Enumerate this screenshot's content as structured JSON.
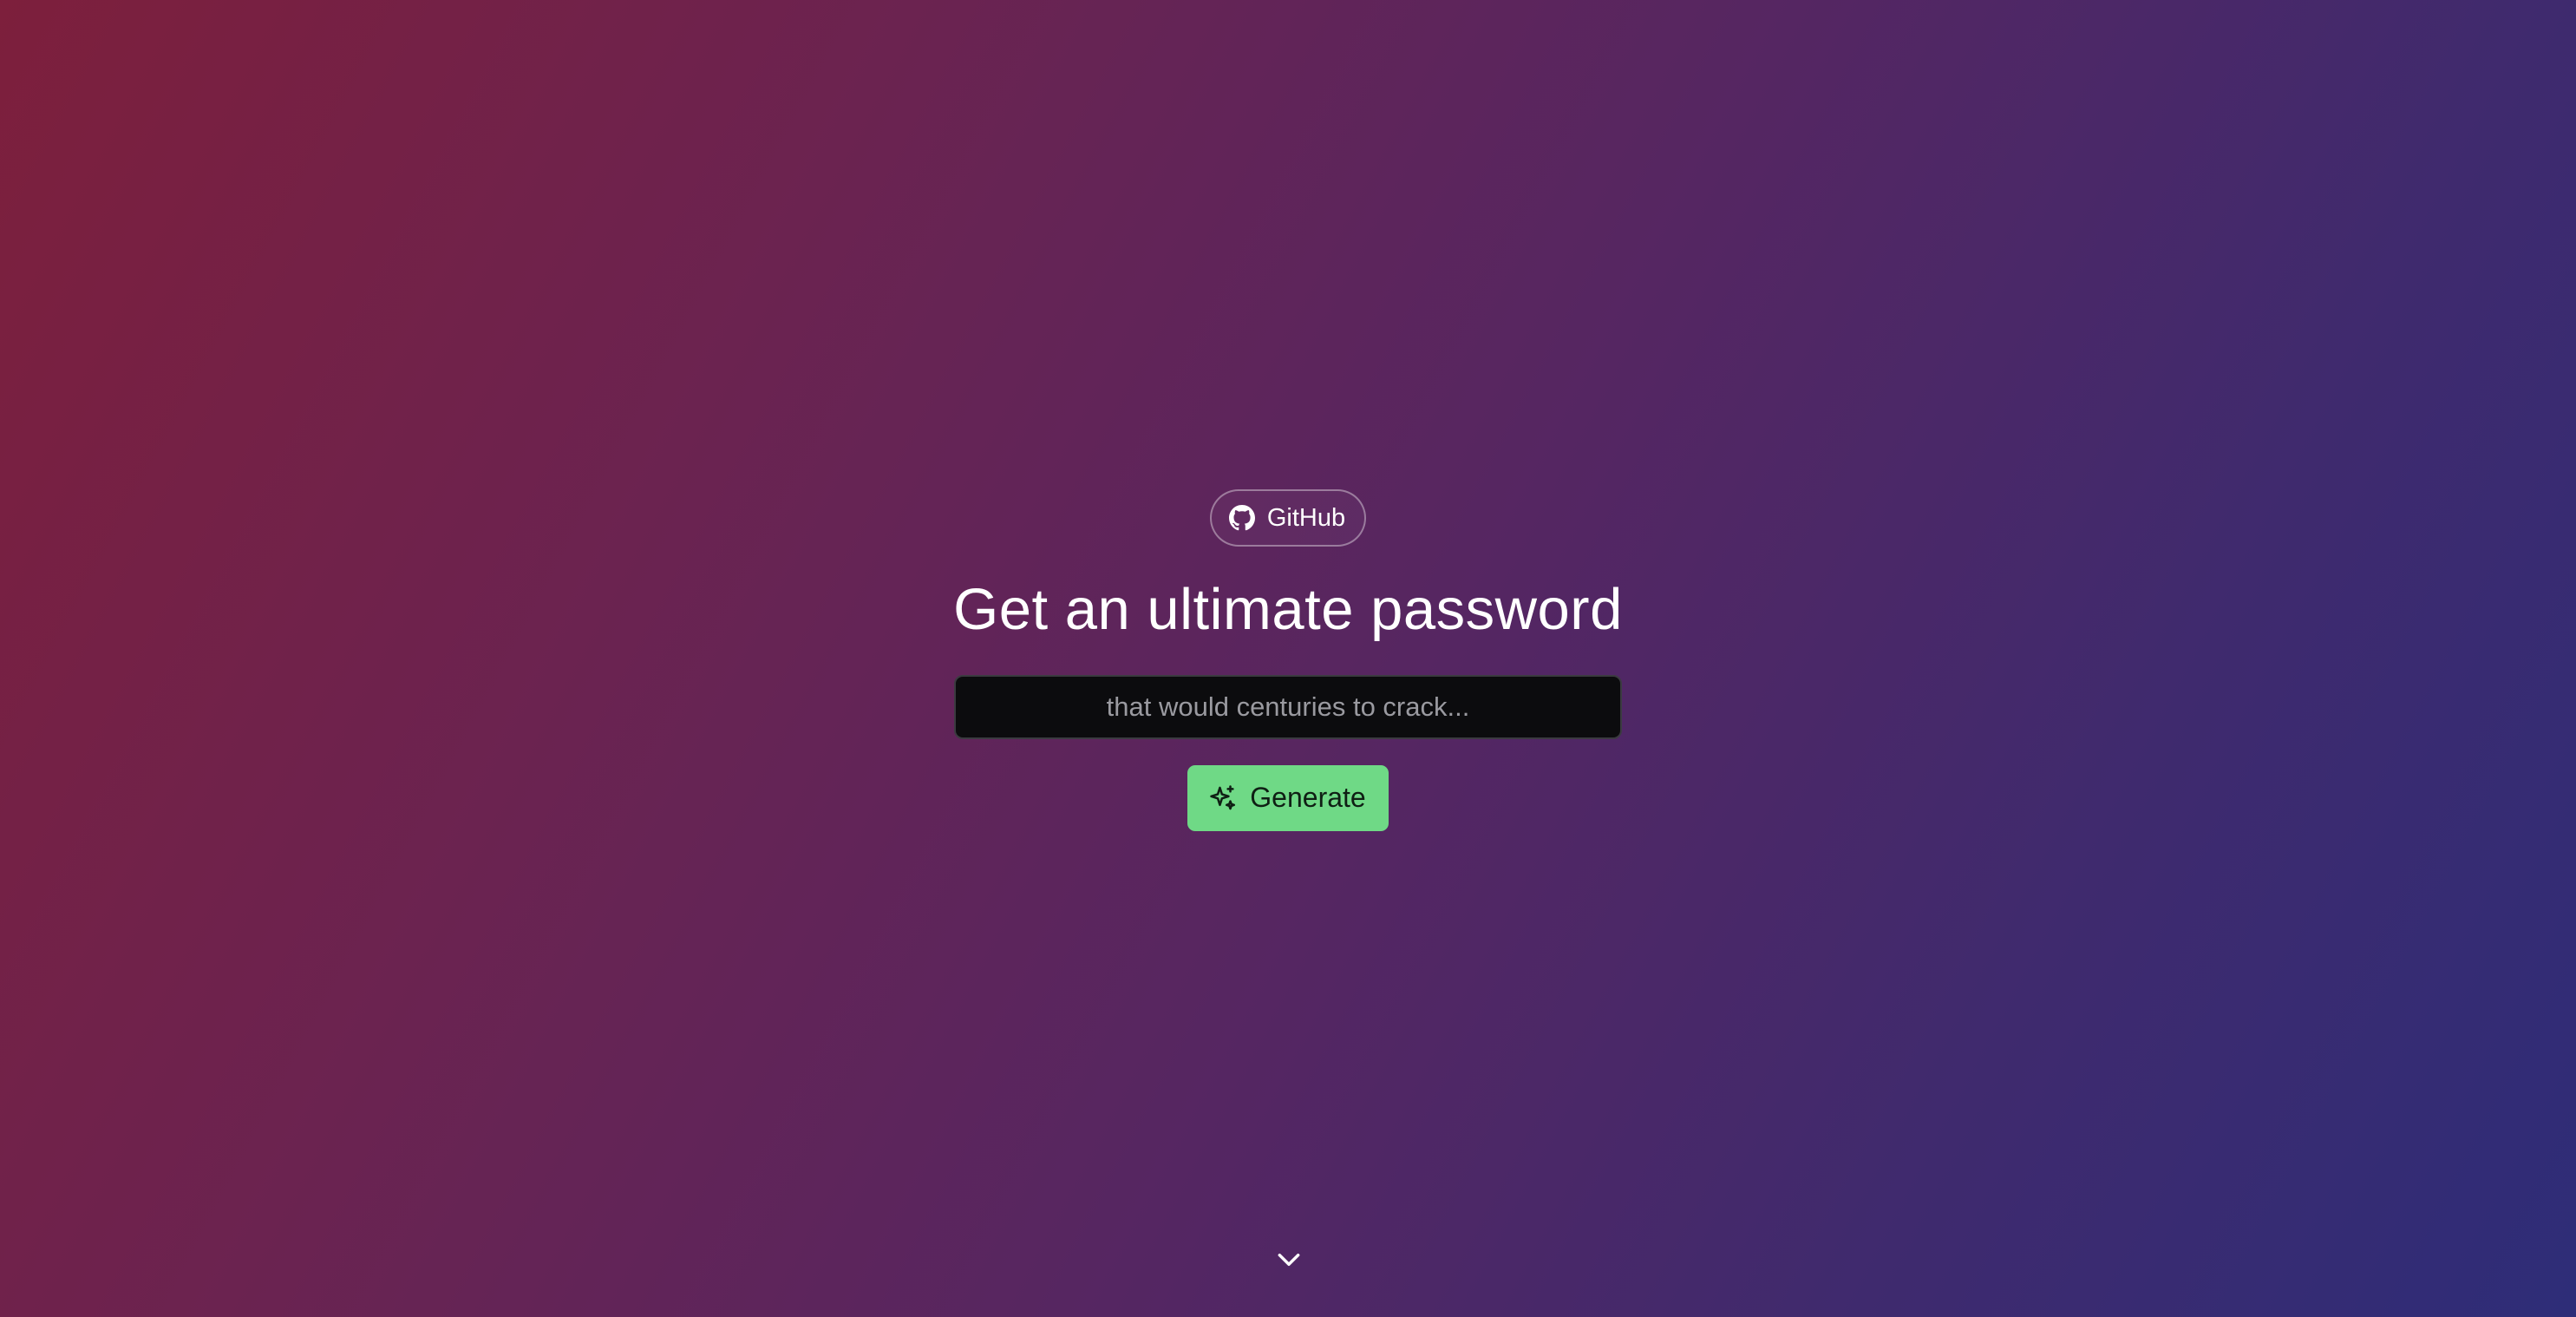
{
  "header": {
    "github_label": "GitHub",
    "github_icon": "github-icon"
  },
  "hero": {
    "title": "Get an ultimate password",
    "input_placeholder": "that would centuries to crack...",
    "input_value": "",
    "generate_label": "Generate",
    "generate_icon": "sparkles-icon"
  },
  "footer": {
    "scroll_icon": "chevron-down-icon"
  },
  "colors": {
    "gradient_start": "#7d1f3c",
    "gradient_end": "#2e2d78",
    "accent_green": "#6fd986",
    "input_background": "#0c0c0e"
  }
}
